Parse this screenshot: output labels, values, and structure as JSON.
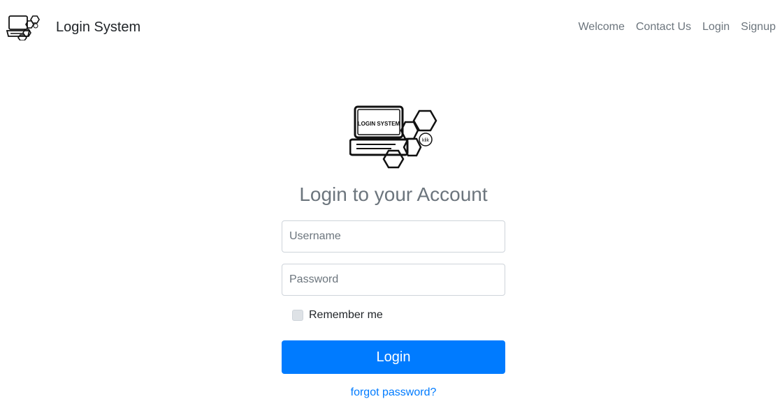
{
  "navbar": {
    "brand": "Login System",
    "links": [
      "Welcome",
      "Contact Us",
      "Login",
      "Signup"
    ]
  },
  "logo": {
    "text": "LOGIN SYSTEM",
    "badge": "klik"
  },
  "form": {
    "heading": "Login to your Account",
    "username_placeholder": "Username",
    "password_placeholder": "Password",
    "remember_label": "Remember me",
    "submit_label": "Login",
    "forgot_label": "forgot password?"
  },
  "colors": {
    "primary": "#007bff",
    "muted": "#6c757d",
    "text": "#212529"
  },
  "icons": {
    "brand_logo": "laptop-hexagon-icon",
    "main_logo": "laptop-hexagon-icon"
  }
}
